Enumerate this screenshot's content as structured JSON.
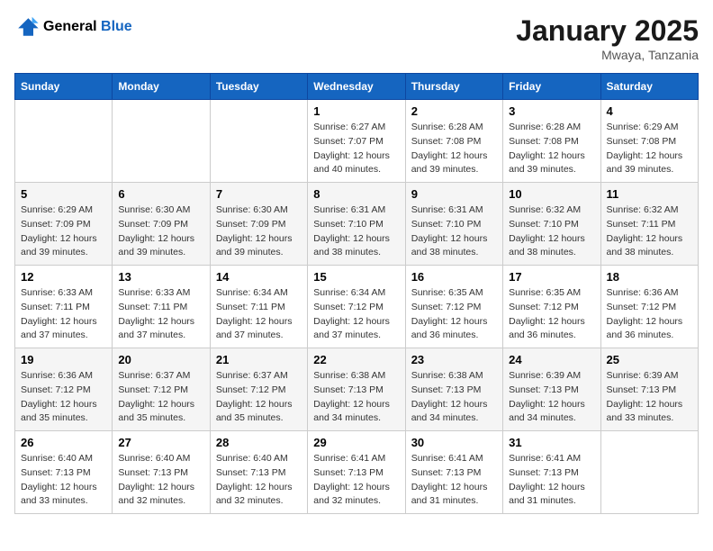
{
  "header": {
    "logo_line1": "General",
    "logo_line2": "Blue",
    "month_title": "January 2025",
    "location": "Mwaya, Tanzania"
  },
  "weekdays": [
    "Sunday",
    "Monday",
    "Tuesday",
    "Wednesday",
    "Thursday",
    "Friday",
    "Saturday"
  ],
  "weeks": [
    [
      {
        "day": "",
        "sunrise": "",
        "sunset": "",
        "daylight": ""
      },
      {
        "day": "",
        "sunrise": "",
        "sunset": "",
        "daylight": ""
      },
      {
        "day": "",
        "sunrise": "",
        "sunset": "",
        "daylight": ""
      },
      {
        "day": "1",
        "sunrise": "Sunrise: 6:27 AM",
        "sunset": "Sunset: 7:07 PM",
        "daylight": "Daylight: 12 hours and 40 minutes."
      },
      {
        "day": "2",
        "sunrise": "Sunrise: 6:28 AM",
        "sunset": "Sunset: 7:08 PM",
        "daylight": "Daylight: 12 hours and 39 minutes."
      },
      {
        "day": "3",
        "sunrise": "Sunrise: 6:28 AM",
        "sunset": "Sunset: 7:08 PM",
        "daylight": "Daylight: 12 hours and 39 minutes."
      },
      {
        "day": "4",
        "sunrise": "Sunrise: 6:29 AM",
        "sunset": "Sunset: 7:08 PM",
        "daylight": "Daylight: 12 hours and 39 minutes."
      }
    ],
    [
      {
        "day": "5",
        "sunrise": "Sunrise: 6:29 AM",
        "sunset": "Sunset: 7:09 PM",
        "daylight": "Daylight: 12 hours and 39 minutes."
      },
      {
        "day": "6",
        "sunrise": "Sunrise: 6:30 AM",
        "sunset": "Sunset: 7:09 PM",
        "daylight": "Daylight: 12 hours and 39 minutes."
      },
      {
        "day": "7",
        "sunrise": "Sunrise: 6:30 AM",
        "sunset": "Sunset: 7:09 PM",
        "daylight": "Daylight: 12 hours and 39 minutes."
      },
      {
        "day": "8",
        "sunrise": "Sunrise: 6:31 AM",
        "sunset": "Sunset: 7:10 PM",
        "daylight": "Daylight: 12 hours and 38 minutes."
      },
      {
        "day": "9",
        "sunrise": "Sunrise: 6:31 AM",
        "sunset": "Sunset: 7:10 PM",
        "daylight": "Daylight: 12 hours and 38 minutes."
      },
      {
        "day": "10",
        "sunrise": "Sunrise: 6:32 AM",
        "sunset": "Sunset: 7:10 PM",
        "daylight": "Daylight: 12 hours and 38 minutes."
      },
      {
        "day": "11",
        "sunrise": "Sunrise: 6:32 AM",
        "sunset": "Sunset: 7:11 PM",
        "daylight": "Daylight: 12 hours and 38 minutes."
      }
    ],
    [
      {
        "day": "12",
        "sunrise": "Sunrise: 6:33 AM",
        "sunset": "Sunset: 7:11 PM",
        "daylight": "Daylight: 12 hours and 37 minutes."
      },
      {
        "day": "13",
        "sunrise": "Sunrise: 6:33 AM",
        "sunset": "Sunset: 7:11 PM",
        "daylight": "Daylight: 12 hours and 37 minutes."
      },
      {
        "day": "14",
        "sunrise": "Sunrise: 6:34 AM",
        "sunset": "Sunset: 7:11 PM",
        "daylight": "Daylight: 12 hours and 37 minutes."
      },
      {
        "day": "15",
        "sunrise": "Sunrise: 6:34 AM",
        "sunset": "Sunset: 7:12 PM",
        "daylight": "Daylight: 12 hours and 37 minutes."
      },
      {
        "day": "16",
        "sunrise": "Sunrise: 6:35 AM",
        "sunset": "Sunset: 7:12 PM",
        "daylight": "Daylight: 12 hours and 36 minutes."
      },
      {
        "day": "17",
        "sunrise": "Sunrise: 6:35 AM",
        "sunset": "Sunset: 7:12 PM",
        "daylight": "Daylight: 12 hours and 36 minutes."
      },
      {
        "day": "18",
        "sunrise": "Sunrise: 6:36 AM",
        "sunset": "Sunset: 7:12 PM",
        "daylight": "Daylight: 12 hours and 36 minutes."
      }
    ],
    [
      {
        "day": "19",
        "sunrise": "Sunrise: 6:36 AM",
        "sunset": "Sunset: 7:12 PM",
        "daylight": "Daylight: 12 hours and 35 minutes."
      },
      {
        "day": "20",
        "sunrise": "Sunrise: 6:37 AM",
        "sunset": "Sunset: 7:12 PM",
        "daylight": "Daylight: 12 hours and 35 minutes."
      },
      {
        "day": "21",
        "sunrise": "Sunrise: 6:37 AM",
        "sunset": "Sunset: 7:12 PM",
        "daylight": "Daylight: 12 hours and 35 minutes."
      },
      {
        "day": "22",
        "sunrise": "Sunrise: 6:38 AM",
        "sunset": "Sunset: 7:13 PM",
        "daylight": "Daylight: 12 hours and 34 minutes."
      },
      {
        "day": "23",
        "sunrise": "Sunrise: 6:38 AM",
        "sunset": "Sunset: 7:13 PM",
        "daylight": "Daylight: 12 hours and 34 minutes."
      },
      {
        "day": "24",
        "sunrise": "Sunrise: 6:39 AM",
        "sunset": "Sunset: 7:13 PM",
        "daylight": "Daylight: 12 hours and 34 minutes."
      },
      {
        "day": "25",
        "sunrise": "Sunrise: 6:39 AM",
        "sunset": "Sunset: 7:13 PM",
        "daylight": "Daylight: 12 hours and 33 minutes."
      }
    ],
    [
      {
        "day": "26",
        "sunrise": "Sunrise: 6:40 AM",
        "sunset": "Sunset: 7:13 PM",
        "daylight": "Daylight: 12 hours and 33 minutes."
      },
      {
        "day": "27",
        "sunrise": "Sunrise: 6:40 AM",
        "sunset": "Sunset: 7:13 PM",
        "daylight": "Daylight: 12 hours and 32 minutes."
      },
      {
        "day": "28",
        "sunrise": "Sunrise: 6:40 AM",
        "sunset": "Sunset: 7:13 PM",
        "daylight": "Daylight: 12 hours and 32 minutes."
      },
      {
        "day": "29",
        "sunrise": "Sunrise: 6:41 AM",
        "sunset": "Sunset: 7:13 PM",
        "daylight": "Daylight: 12 hours and 32 minutes."
      },
      {
        "day": "30",
        "sunrise": "Sunrise: 6:41 AM",
        "sunset": "Sunset: 7:13 PM",
        "daylight": "Daylight: 12 hours and 31 minutes."
      },
      {
        "day": "31",
        "sunrise": "Sunrise: 6:41 AM",
        "sunset": "Sunset: 7:13 PM",
        "daylight": "Daylight: 12 hours and 31 minutes."
      },
      {
        "day": "",
        "sunrise": "",
        "sunset": "",
        "daylight": ""
      }
    ]
  ]
}
